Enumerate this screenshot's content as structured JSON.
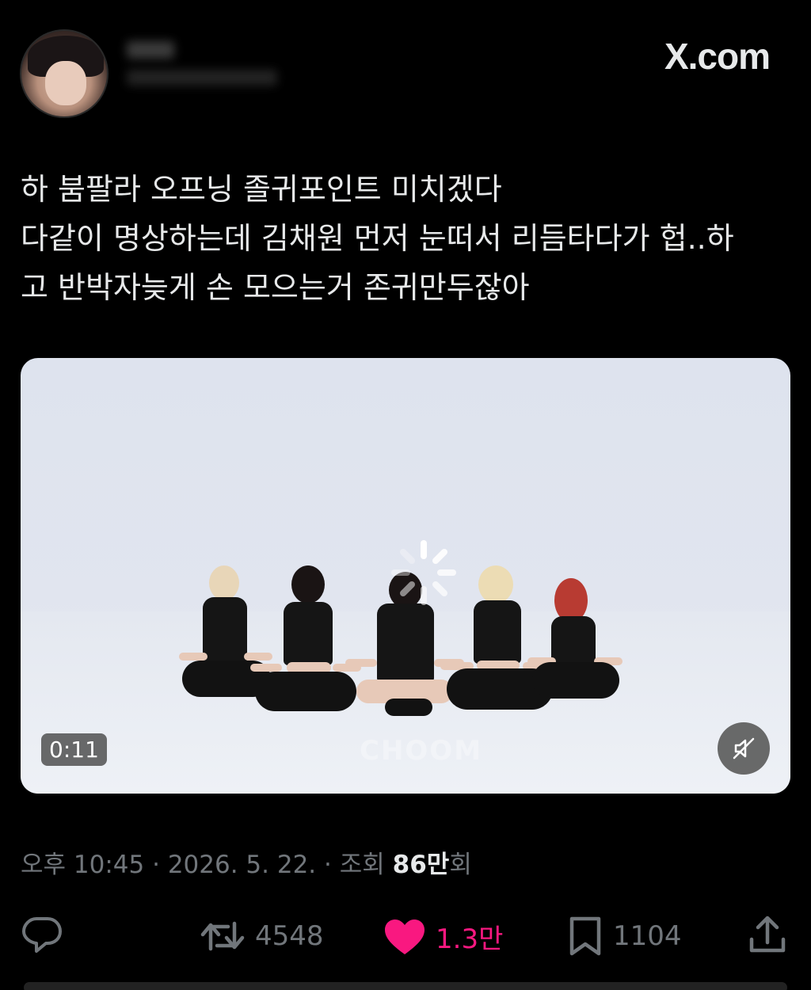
{
  "header": {
    "site_label": "X.com",
    "avatar_icon": "profile-avatar"
  },
  "tweet": {
    "text": "하 붐팔라 오프닝 졸귀포인트 미치겠다\n다같이 명상하는데 김채원 먼저 눈떠서 리듬타다가 헙..하\n고 반박자늦게 손 모으는거 존귀만두잖아"
  },
  "video": {
    "duration": "0:11",
    "watermark": "CHOOM",
    "mute_icon": "speaker-muted-icon"
  },
  "meta": {
    "time": "오후 10:45",
    "date": "2026. 5. 22.",
    "views_label": "조회",
    "views_value": "86만",
    "views_suffix": "회",
    "separator": "·"
  },
  "actions": {
    "reply_icon": "reply-icon",
    "retweets": "4548",
    "likes": "1.3만",
    "bookmarks": "1104",
    "share_icon": "share-icon",
    "like_color": "#f91880"
  }
}
